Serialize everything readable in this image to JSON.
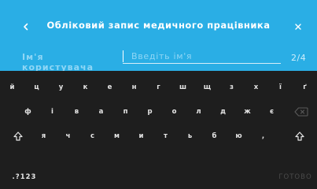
{
  "header": {
    "title": "Обліковий запис медичного працівника",
    "back_icon": "chevron-left-icon",
    "close_icon": "close-icon"
  },
  "form": {
    "label": "Ім'я користувача",
    "placeholder": "Введіть ім'я",
    "counter": "2/4"
  },
  "keyboard": {
    "row1": [
      "й",
      "ц",
      "у",
      "к",
      "е",
      "н",
      "г",
      "ш",
      "щ",
      "з",
      "х",
      "ї",
      "ґ"
    ],
    "row2": [
      "ф",
      "і",
      "в",
      "а",
      "п",
      "р",
      "о",
      "л",
      "д",
      "ж",
      "є"
    ],
    "row3": [
      "я",
      "ч",
      "с",
      "м",
      "и",
      "т",
      "ь",
      "б",
      "ю",
      ","
    ],
    "backspace_icon": "backspace-icon",
    "shift_icon": "shift-icon",
    "numbers_label": ".?123",
    "done_label": "ГОТОВО"
  },
  "colors": {
    "header_bg": "#2aaee5",
    "keyboard_bg": "#1e1e1e"
  }
}
